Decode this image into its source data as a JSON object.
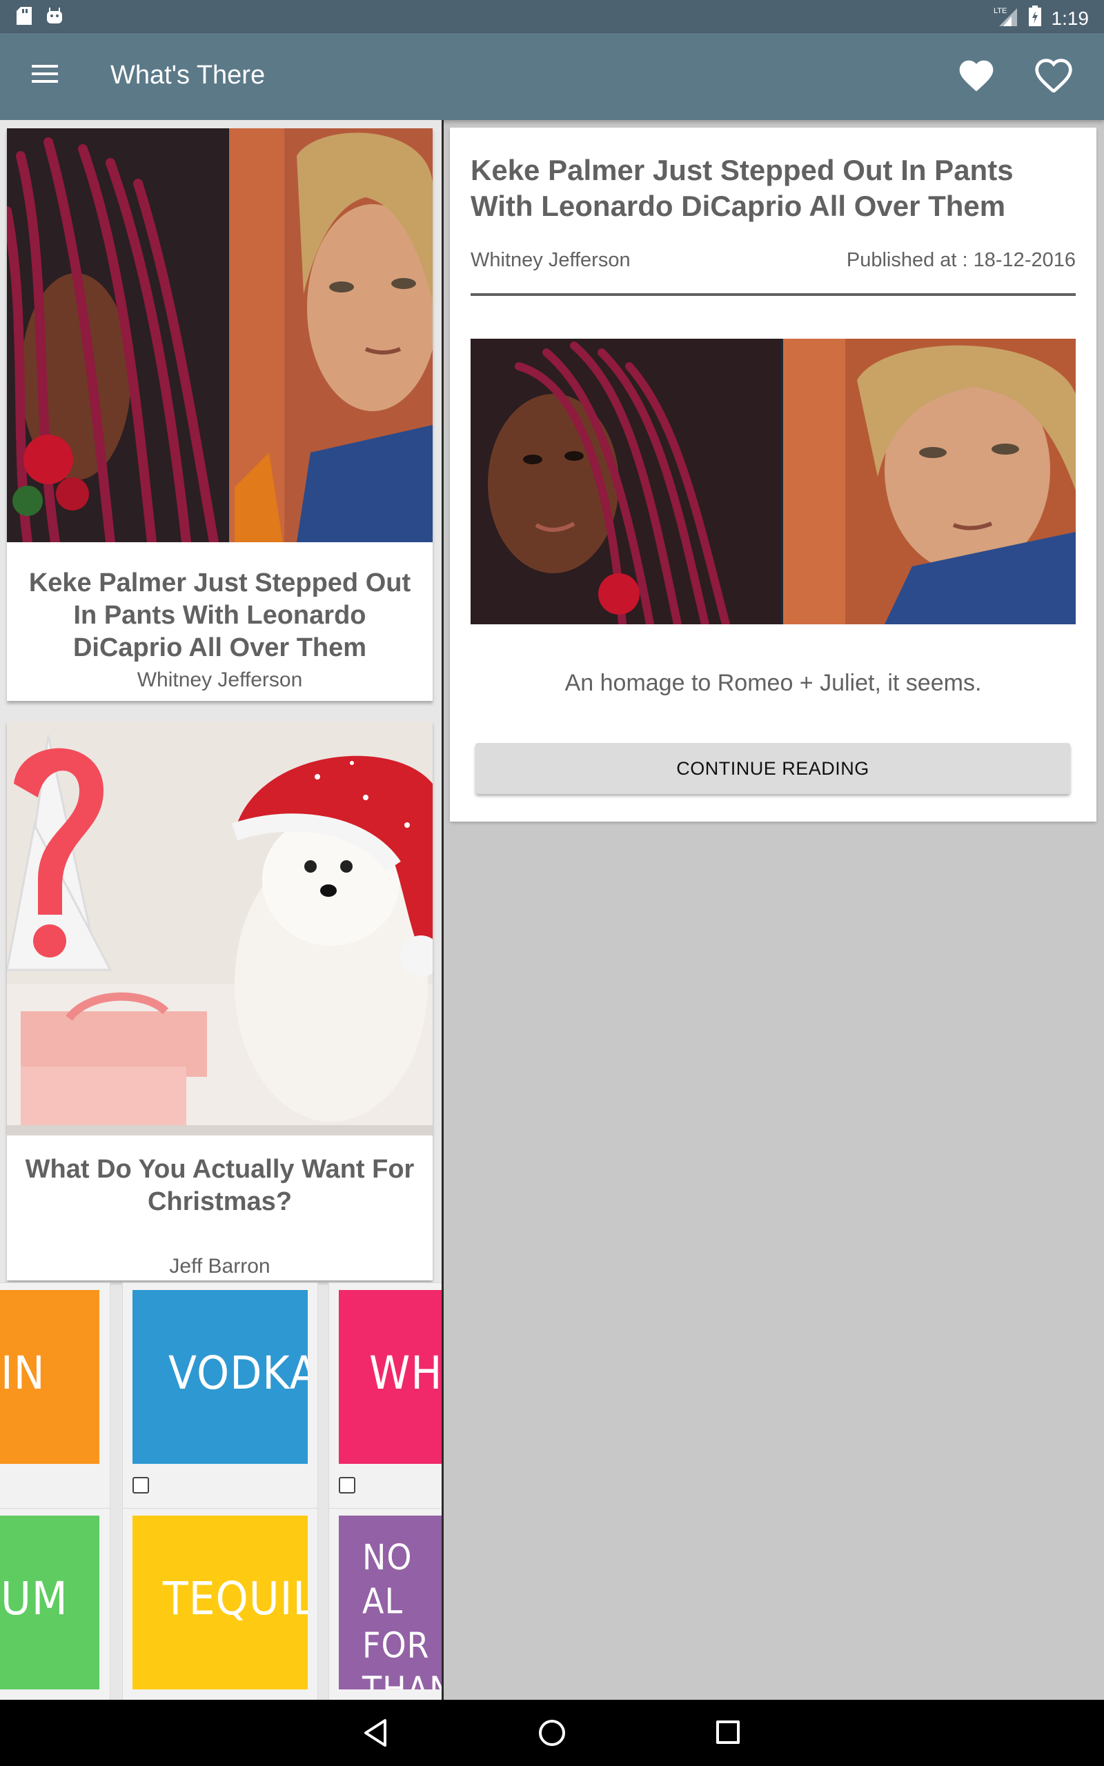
{
  "status_bar": {
    "time": "1:19",
    "network": "LTE",
    "icons": [
      "sd-card-icon",
      "android-icon",
      "lte-signal-icon",
      "battery-icon"
    ]
  },
  "app_bar": {
    "title": "What's There",
    "icons": [
      "menu-icon",
      "heart-filled-icon",
      "heart-outline-icon"
    ]
  },
  "feed": {
    "cards": [
      {
        "title": "Keke Palmer Just Stepped Out In Pants With Leonardo DiCaprio All Over Them",
        "author": "Whitney Jefferson"
      },
      {
        "title": "What Do You Actually Want For Christmas?",
        "author": "Jeff Barron"
      }
    ],
    "tiles_row1": [
      "IN",
      "VODKA",
      "WHIS"
    ],
    "tiles_row2": [
      "UM",
      "TEQUILA",
      "NO AL FOR THAN"
    ]
  },
  "detail": {
    "title": "Keke Palmer Just Stepped Out In Pants With Leonardo DiCaprio All Over Them",
    "author": "Whitney Jefferson",
    "published": "Published at : 18-12-2016",
    "teaser": "An homage to Romeo + Juliet, it seems.",
    "button_label": "CONTINUE READING"
  },
  "colors": {
    "status_bar": "#4d6270",
    "app_bar": "#5c7988",
    "text_gray": "#616161",
    "tile_orange": "#f9951d",
    "tile_blue": "#2e98d2",
    "tile_pink": "#f1296a",
    "tile_green": "#5fcc62",
    "tile_yellow": "#fecb12",
    "tile_purple": "#9361a5"
  },
  "nav_bar": {
    "icons": [
      "back-icon",
      "home-icon",
      "recents-icon"
    ]
  }
}
